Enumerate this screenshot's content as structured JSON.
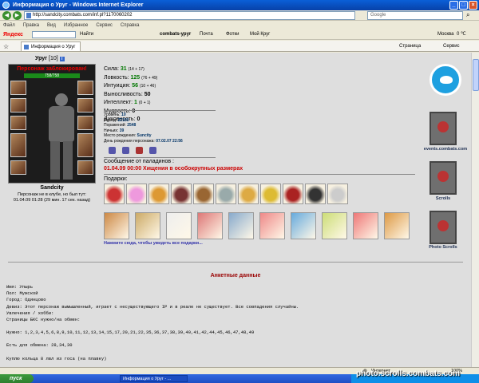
{
  "window": {
    "title": "Информация о Уруг - Windows Internet Explorer",
    "controls": [
      "_",
      "□",
      "×"
    ]
  },
  "address": {
    "url": "http://sandcity.combats.com/inf.pl?1170060202",
    "search_placeholder": "Google"
  },
  "menu": [
    "Файл",
    "Правка",
    "Вид",
    "Избранное",
    "Сервис",
    "Справка"
  ],
  "yandex": {
    "logo": "Яндекс",
    "find": "Найти",
    "items": [
      "combats-урyr",
      "Почта",
      "Фотки",
      "Мой Круг"
    ],
    "city": "Москва",
    "temp": "0 ℃"
  },
  "tab": {
    "title": "Информация о Уруг",
    "right_items": [
      "Страница",
      "Сервис"
    ]
  },
  "character": {
    "name": "Уруг",
    "level": "[10]",
    "blocked": "Персонаж заблокирован!",
    "hp": "758/758",
    "city": "Sandcity",
    "offline_line1": "Персонаж не в клубе, но был тут:",
    "offline_line2": "01.04.09 01:28 (29 мин. 17 сек. назад)"
  },
  "stats": [
    {
      "label": "Сила:",
      "value": "31",
      "extra": "(14 + 17)",
      "green": true
    },
    {
      "label": "Ловкость:",
      "value": "125",
      "extra": "(76 + 49)",
      "green": true
    },
    {
      "label": "Интуиция:",
      "value": "56",
      "extra": "(10 + 46)",
      "green": true
    },
    {
      "label": "Выносливость:",
      "value": "50",
      "extra": "",
      "green": false
    },
    {
      "label": "Интеллект:",
      "value": "1",
      "extra": "(0 + 1)",
      "green": true
    },
    {
      "label": "Мудрость:",
      "value": "0",
      "extra": "",
      "green": false
    },
    {
      "label": "Духовность:",
      "value": "0",
      "extra": "",
      "green": false
    }
  ],
  "details": [
    {
      "label": "Уровень:",
      "value": "10"
    },
    {
      "label": "Побед:",
      "value": "22180"
    },
    {
      "label": "Поражений:",
      "value": "2548"
    },
    {
      "label": "Ничьих:",
      "value": "39"
    },
    {
      "label": "Место рождения:",
      "value": "Suncity"
    },
    {
      "label": "День рождения персонажа:",
      "value": "07.02.07 22:56"
    }
  ],
  "message": {
    "title": "Сообщение от паладинов :",
    "text": "01.04.09 00:00 Хищения в особокрупных размерах"
  },
  "gifts": {
    "label": "Подарки:",
    "link": "Нажмите сюда, чтобы увидеть все подарки..."
  },
  "right": {
    "events_label": "events.combats.com",
    "scrolls_label": "Scrolls",
    "photo_label": "Photo Scrolls"
  },
  "anket": {
    "title": "Анкетные данные",
    "lines": [
      "Имя: Упырь",
      "Пол: Мужской",
      "Город: Одинцово",
      "Девиз: Этот персонаж вымышленный, играет с несуществующего IP и в реале не существует. Все совпадения случайны.",
      "Увлечения / хобби:",
      "Страницы БКС нужно/на обмен:",
      "",
      "Нужно: 1,2,3,4,5,6,8,9,10,11,12,13,14,15,17,20,21,22,35,36,37,38,39,40,41,42,44,45,46,47,48,49",
      "",
      "Есть для обмена: 28,34,30",
      "",
      "Куплю кольца 8 лвл из госа (на плавку)"
    ]
  },
  "status": {
    "zone": "Интернет",
    "zoom": "100%"
  },
  "taskbar": {
    "start": "пуск",
    "task": "Информация о Уруг - ..."
  },
  "watermark": "photo.scrolls.combats.com"
}
